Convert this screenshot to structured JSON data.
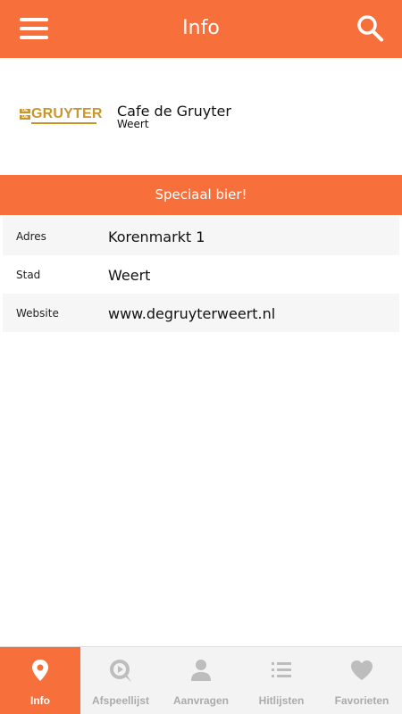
{
  "header": {
    "title": "Info",
    "menu_icon": "hamburger-menu-icon",
    "search_icon": "search-icon"
  },
  "venue": {
    "logo": {
      "small_text_top": "DE",
      "small_text_bottom": "DE",
      "word": "GRUYTER",
      "color": "#c9962c"
    },
    "name": "Cafe de Gruyter",
    "city": "Weert"
  },
  "banner": {
    "text": "Speciaal bier!"
  },
  "details": [
    {
      "key": "Adres",
      "value": "Korenmarkt 1"
    },
    {
      "key": "Stad",
      "value": "Weert"
    },
    {
      "key": "Website",
      "value": "www.degruyterweert.nl"
    }
  ],
  "tabs": [
    {
      "label": "Info",
      "icon": "location-pin-icon",
      "active": true
    },
    {
      "label": "Afspeellijst",
      "icon": "playlist-play-icon",
      "active": false
    },
    {
      "label": "Aanvragen",
      "icon": "person-icon",
      "active": false
    },
    {
      "label": "Hitlijsten",
      "icon": "list-icon",
      "active": false
    },
    {
      "label": "Favorieten",
      "icon": "heart-icon",
      "active": false
    }
  ],
  "colors": {
    "accent": "#f7703c",
    "tab_inactive": "#ababab",
    "row_alt": "#f6f6f6"
  }
}
